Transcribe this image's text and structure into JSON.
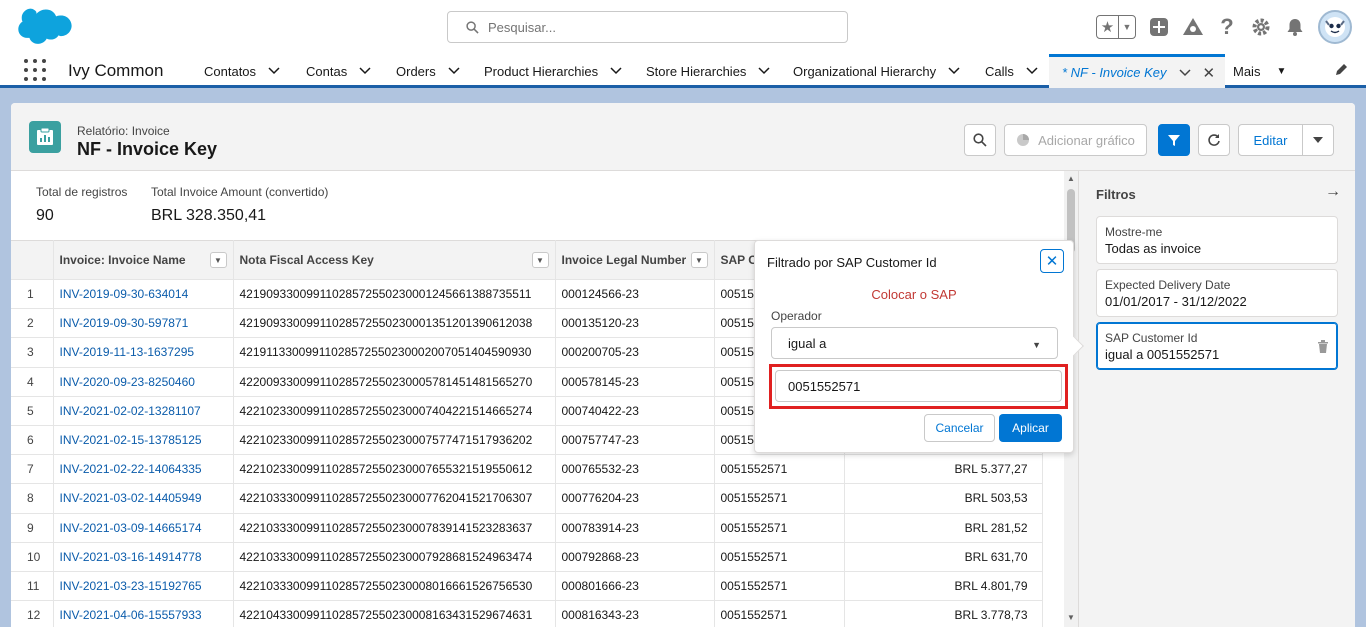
{
  "header": {
    "search_placeholder": "Pesquisar..."
  },
  "nav": {
    "app_name": "Ivy Common",
    "items": [
      {
        "label": "Contatos"
      },
      {
        "label": "Contas"
      },
      {
        "label": "Orders"
      },
      {
        "label": "Product Hierarchies"
      },
      {
        "label": "Store Hierarchies"
      },
      {
        "label": "Organizational Hierarchy"
      },
      {
        "label": "Calls"
      },
      {
        "label": "* NF - Invoice Key"
      },
      {
        "label": "Mais"
      }
    ]
  },
  "report": {
    "kicker": "Relatório: Invoice",
    "title": "NF - Invoice Key",
    "add_chart_label": "Adicionar gráfico",
    "edit_label": "Editar",
    "summary": {
      "total_records_label": "Total de registros",
      "total_records_value": "90",
      "total_amount_label": "Total Invoice Amount (convertido)",
      "total_amount_value": "BRL 328.350,41"
    },
    "columns": [
      "Invoice: Invoice Name",
      "Nota Fiscal Access Key",
      "Invoice Legal Number",
      "SAP C"
    ],
    "rows": [
      {
        "n": "1",
        "name": "INV-2019-09-30-634014",
        "key": "42190933009911028572550230001245661388735511",
        "legal": "000124566-23",
        "sap": "00515",
        "amount": ""
      },
      {
        "n": "2",
        "name": "INV-2019-09-30-597871",
        "key": "42190933009911028572550230001351201390612038",
        "legal": "000135120-23",
        "sap": "00515",
        "amount": ""
      },
      {
        "n": "3",
        "name": "INV-2019-11-13-1637295",
        "key": "42191133009911028572550230002007051404590930",
        "legal": "000200705-23",
        "sap": "00515",
        "amount": ""
      },
      {
        "n": "4",
        "name": "INV-2020-09-23-8250460",
        "key": "42200933009911028572550230005781451481565270",
        "legal": "000578145-23",
        "sap": "00515",
        "amount": ""
      },
      {
        "n": "5",
        "name": "INV-2021-02-02-13281107",
        "key": "42210233009911028572550230007404221514665274",
        "legal": "000740422-23",
        "sap": "00515",
        "amount": ""
      },
      {
        "n": "6",
        "name": "INV-2021-02-15-13785125",
        "key": "42210233009911028572550230007577471517936202",
        "legal": "000757747-23",
        "sap": "00515",
        "amount": ""
      },
      {
        "n": "7",
        "name": "INV-2021-02-22-14064335",
        "key": "42210233009911028572550230007655321519550612",
        "legal": "000765532-23",
        "sap": "0051552571",
        "amount": "BRL 5.377,27"
      },
      {
        "n": "8",
        "name": "INV-2021-03-02-14405949",
        "key": "42210333009911028572550230007762041521706307",
        "legal": "000776204-23",
        "sap": "0051552571",
        "amount": "BRL 503,53"
      },
      {
        "n": "9",
        "name": "INV-2021-03-09-14665174",
        "key": "42210333009911028572550230007839141523283637",
        "legal": "000783914-23",
        "sap": "0051552571",
        "amount": "BRL 281,52"
      },
      {
        "n": "10",
        "name": "INV-2021-03-16-14914778",
        "key": "42210333009911028572550230007928681524963474",
        "legal": "000792868-23",
        "sap": "0051552571",
        "amount": "BRL 631,70"
      },
      {
        "n": "11",
        "name": "INV-2021-03-23-15192765",
        "key": "42210333009911028572550230008016661526756530",
        "legal": "000801666-23",
        "sap": "0051552571",
        "amount": "BRL 4.801,79"
      },
      {
        "n": "12",
        "name": "INV-2021-04-06-15557933",
        "key": "42210433009911028572550230008163431529674631",
        "legal": "000816343-23",
        "sap": "0051552571",
        "amount": "BRL 3.778,73"
      }
    ]
  },
  "filters": {
    "title": "Filtros",
    "cards": [
      {
        "label": "Mostre-me",
        "value": "Todas as invoice"
      },
      {
        "label": "Expected Delivery Date",
        "value": "01/01/2017 - 31/12/2022"
      },
      {
        "label": "SAP Customer Id",
        "value": "igual a 0051552571"
      }
    ]
  },
  "popover": {
    "title": "Filtrado por SAP Customer Id",
    "error": "Colocar o SAP",
    "operator_label": "Operador",
    "operator_value": "igual a",
    "input_value": "0051552571",
    "cancel_label": "Cancelar",
    "apply_label": "Aplicar"
  },
  "colors": {
    "brand": "#0176d3",
    "header_blue": "#1b5fa7",
    "error_red": "#e02020",
    "report_icon": "#3ba0a0"
  }
}
